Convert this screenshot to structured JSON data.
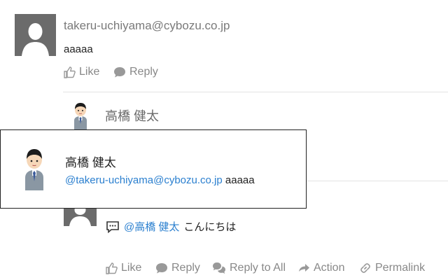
{
  "post": {
    "author": "takeru-uchiyama@cybozu.co.jp",
    "body": "aaaaa",
    "actions": {
      "like": "Like",
      "reply": "Reply"
    }
  },
  "reply_header": {
    "name": "高橋 健太"
  },
  "popup": {
    "name": "高橋 健太",
    "mention": "@takeru-uchiyama@cybozu.co.jp",
    "quote": "aaaaa"
  },
  "comment": {
    "mention": "@高橋 健太",
    "text": "こんにちは",
    "actions": {
      "like": "Like",
      "reply": "Reply",
      "reply_all": "Reply to All",
      "action": "Action",
      "permalink": "Permalink"
    }
  },
  "colors": {
    "link": "#2a7fcf",
    "muted": "#888888",
    "avatar_bg": "#6b6b6b"
  }
}
